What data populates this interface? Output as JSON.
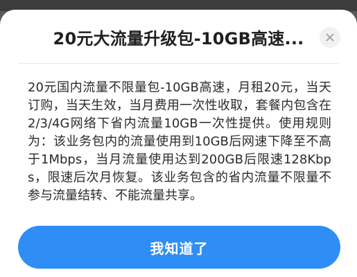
{
  "dialog": {
    "title": "20元大流量升级包-10GB高速...",
    "description": "20元国内流量不限量包-10GB高速，月租20元，当天订购，当天生效，当月费用一次性收取，套餐内包含在2/3/4G网络下省内流量10GB一次性提供。使用规则为：该业务包内的流量使用到10GB后网速下降至不高于1Mbps，当月流量使用达到200GB后限速128Kbps，限速后次月恢复。该业务包含的省内流量不限量不参与流量结转、不能流量共享。",
    "confirm_label": "我知道了",
    "close_icon": "close-icon"
  },
  "colors": {
    "accent": "#2f8ef6",
    "backdrop": "#5a5a5a"
  }
}
